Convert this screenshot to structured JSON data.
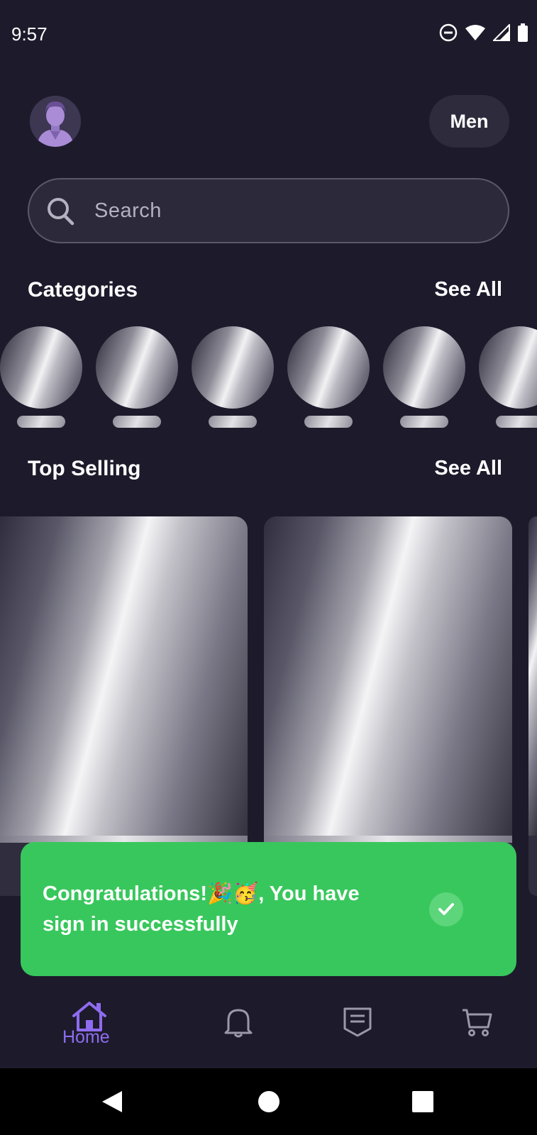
{
  "status_bar": {
    "time": "9:57",
    "icons": [
      "do-not-disturb-icon",
      "wifi-icon",
      "signal-icon",
      "battery-icon"
    ]
  },
  "header": {
    "avatar_icon": "user-avatar-icon",
    "gender_selector": "Men"
  },
  "search": {
    "placeholder": "Search",
    "icon": "search-icon"
  },
  "categories": {
    "title": "Categories",
    "see_all": "See All",
    "item_count_visible": 6
  },
  "top_selling": {
    "title": "Top Selling",
    "see_all": "See All"
  },
  "toast": {
    "message": "Congratulations!🎉🥳, You have sign in successfully",
    "icon": "check-icon",
    "color": "#38c75c"
  },
  "bottom_nav": {
    "items": [
      {
        "icon": "home-icon",
        "label": "Home",
        "active": true
      },
      {
        "icon": "bell-icon",
        "label": "",
        "active": false
      },
      {
        "icon": "receipt-icon",
        "label": "",
        "active": false
      },
      {
        "icon": "cart-icon",
        "label": "",
        "active": false
      }
    ],
    "active_color": "#8e6cf0"
  },
  "system_nav": {
    "icons": [
      "back-icon",
      "home-circle-icon",
      "recents-icon"
    ]
  },
  "colors": {
    "background": "#1d1b2b",
    "surface": "#2e2b3c",
    "accent": "#8e6cf0"
  }
}
